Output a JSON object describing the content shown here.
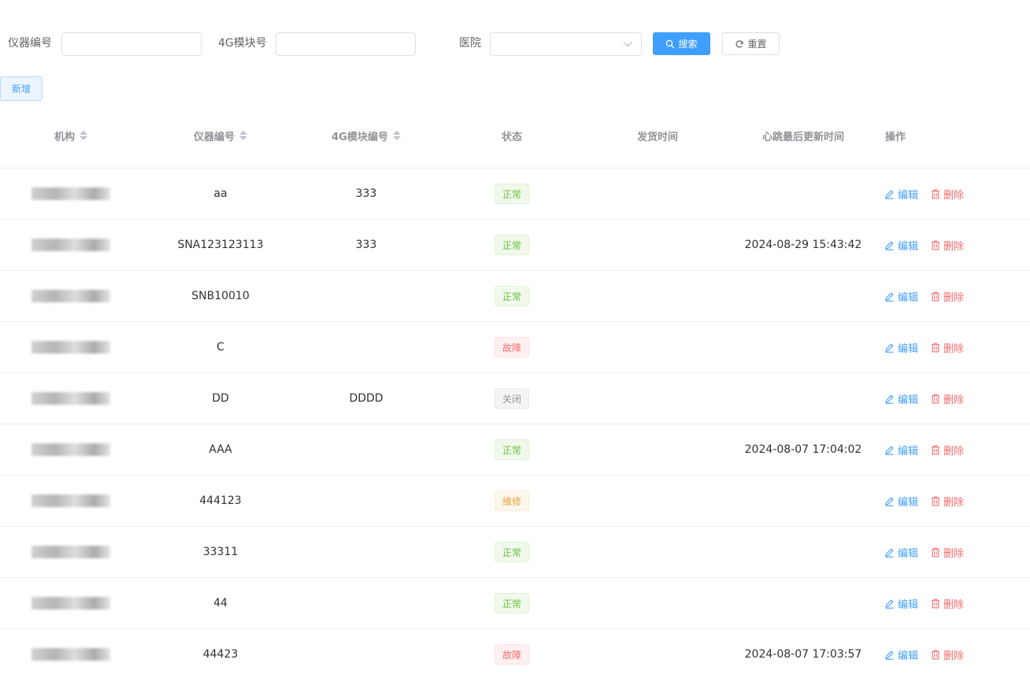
{
  "search": {
    "device_no_label": "仪器编号",
    "device_no_value": "",
    "module_no_label": "4G模块号",
    "module_no_value": "",
    "hospital_label": "医院",
    "hospital_value": "",
    "search_button": "搜索",
    "reset_button": "重置"
  },
  "toolbar": {
    "add_button": "新增"
  },
  "table": {
    "headers": {
      "org": "机构",
      "device_no": "仪器编号",
      "module_no": "4G模块编号",
      "status": "状态",
      "ship_time": "发货时间",
      "heartbeat_time": "心跳最后更新时间",
      "actions": "操作"
    },
    "edit_label": "编辑",
    "delete_label": "删除",
    "rows": [
      {
        "device_no": "aa",
        "module_no": "333",
        "status": "正常",
        "status_color": "green",
        "ship_time": "",
        "heartbeat_time": ""
      },
      {
        "device_no": "SNA123123113",
        "module_no": "333",
        "status": "正常",
        "status_color": "green",
        "ship_time": "",
        "heartbeat_time": "2024-08-29 15:43:42"
      },
      {
        "device_no": "SNB10010",
        "module_no": "",
        "status": "正常",
        "status_color": "green",
        "ship_time": "",
        "heartbeat_time": ""
      },
      {
        "device_no": "C",
        "module_no": "",
        "status": "故障",
        "status_color": "red",
        "ship_time": "",
        "heartbeat_time": ""
      },
      {
        "device_no": "DD",
        "module_no": "DDDD",
        "status": "关闭",
        "status_color": "gray",
        "ship_time": "",
        "heartbeat_time": ""
      },
      {
        "device_no": "AAA",
        "module_no": "",
        "status": "正常",
        "status_color": "green",
        "ship_time": "",
        "heartbeat_time": "2024-08-07 17:04:02"
      },
      {
        "device_no": "444123",
        "module_no": "",
        "status": "维修",
        "status_color": "orange",
        "ship_time": "",
        "heartbeat_time": ""
      },
      {
        "device_no": "33311",
        "module_no": "",
        "status": "正常",
        "status_color": "green",
        "ship_time": "",
        "heartbeat_time": ""
      },
      {
        "device_no": "44",
        "module_no": "",
        "status": "正常",
        "status_color": "green",
        "ship_time": "",
        "heartbeat_time": ""
      },
      {
        "device_no": "44423",
        "module_no": "",
        "status": "故障",
        "status_color": "red",
        "ship_time": "",
        "heartbeat_time": "2024-08-07 17:03:57"
      }
    ]
  },
  "colors": {
    "primary": "#409eff",
    "success": "#67c23a",
    "danger": "#f56c6c",
    "warning": "#e6a23c",
    "info": "#909399"
  },
  "icons": {
    "search": "search-icon",
    "reset": "refresh-icon",
    "select": "chevron-down-icon",
    "edit": "edit-icon",
    "delete": "trash-icon",
    "sort": "sort-icon"
  }
}
